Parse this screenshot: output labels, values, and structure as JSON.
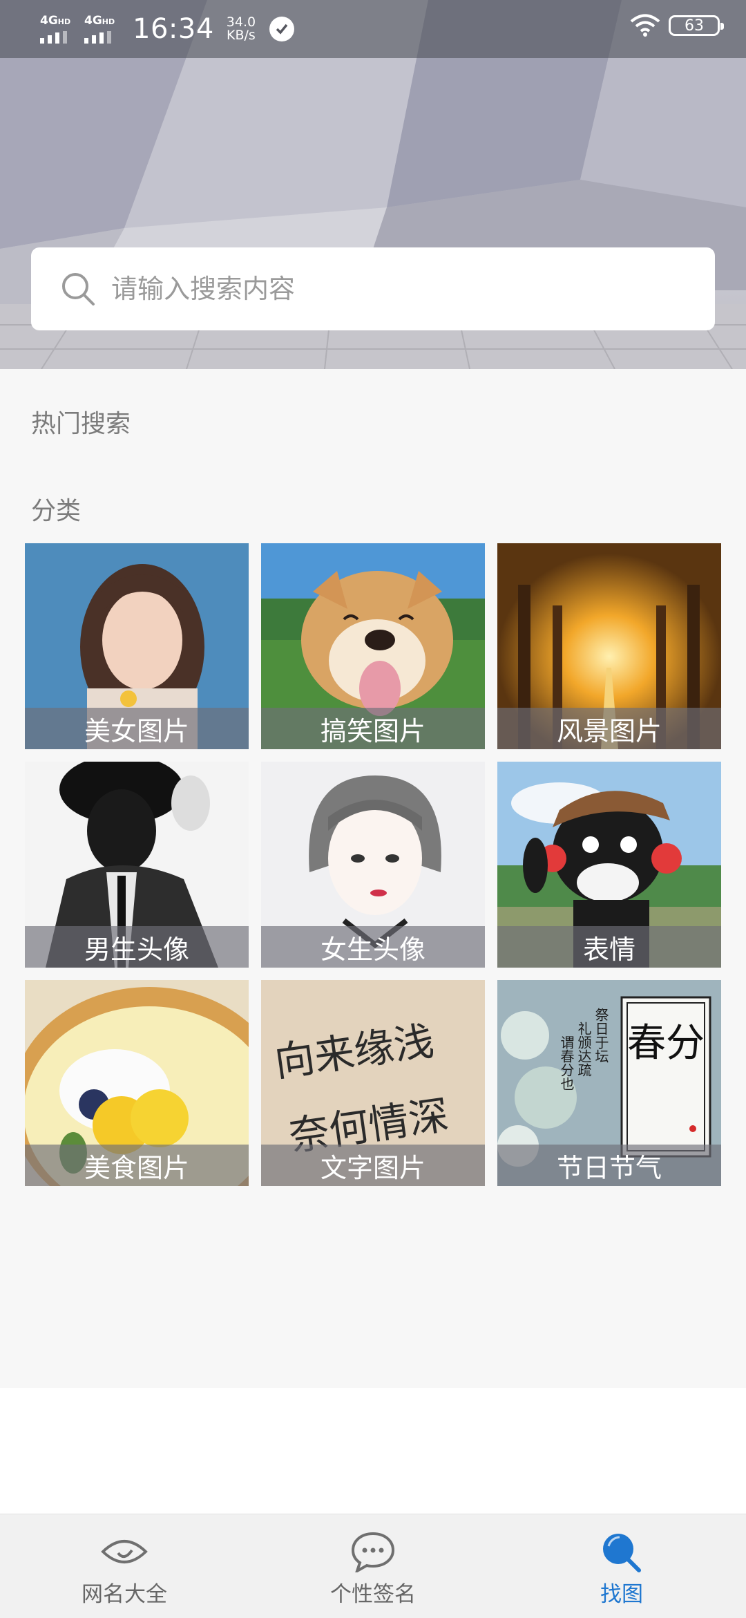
{
  "status_bar": {
    "sim1": "4G",
    "sim1_sup": "HD",
    "sim2": "4G",
    "sim2_sup": "HD",
    "time": "16:34",
    "speed_value": "34.0",
    "speed_unit": "KB/s",
    "battery": "63"
  },
  "search": {
    "placeholder": "请输入搜索内容"
  },
  "sections": {
    "hot": "热门搜索",
    "category": "分类"
  },
  "categories": [
    {
      "label": "美女图片"
    },
    {
      "label": "搞笑图片"
    },
    {
      "label": "风景图片"
    },
    {
      "label": "男生头像"
    },
    {
      "label": "女生头像"
    },
    {
      "label": "表情"
    },
    {
      "label": "美食图片"
    },
    {
      "label": "文字图片"
    },
    {
      "label": "节日节气"
    }
  ],
  "tile_text": {
    "calligraphy_line1": "向来缘浅",
    "calligraphy_line2": "奈何情深",
    "spring_big": "春分",
    "spring_vertical_1": "祭日于坛",
    "spring_vertical_2": "礼颁达疏",
    "spring_vertical_3": "谓春分也"
  },
  "tabbar": {
    "tabs": [
      {
        "label": "网名大全",
        "icon": "eye-icon"
      },
      {
        "label": "个性签名",
        "icon": "chat-bubble-icon"
      },
      {
        "label": "找图",
        "icon": "search-icon"
      }
    ],
    "active_color": "#1f77d0"
  }
}
